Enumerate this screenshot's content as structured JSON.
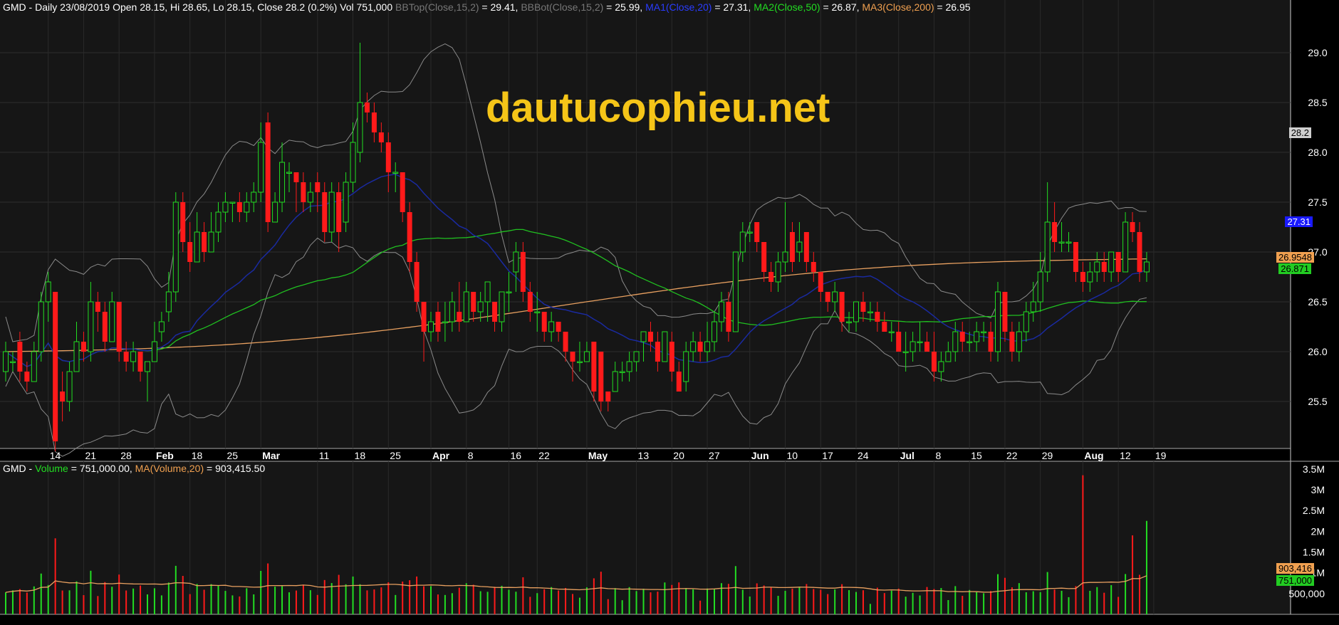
{
  "header": {
    "symbol": "GMD",
    "info": " - Daily 23/08/2019 Open 28.15, Hi 28.65, Lo 28.15, Close 28.2 (0.2%) Vol 751,000 ",
    "bbtop_name": "BBTop(Close,15,2)",
    "bbtop_val": " = 29.41, ",
    "bbbot_name": "BBBot(Close,15,2)",
    "bbbot_val": " = 25.99, ",
    "ma1_name": "MA1(Close,20)",
    "ma1_val": " = 27.31, ",
    "ma2_name": "MA2(Close,50)",
    "ma2_val": " = 26.87, ",
    "ma3_name": "MA3(Close,200)",
    "ma3_val": " = 26.95"
  },
  "volume_header": {
    "symbol": "GMD",
    "dash": " - ",
    "vol_name": "Volume",
    "vol_val": " = 751,000.00, ",
    "ma_name": "MA(Volume,20)",
    "ma_val": " = 903,415.50"
  },
  "watermark": "dautucophieu.net",
  "price_tags": {
    "close": "28.2",
    "ma1": "27.31",
    "ma3": "26.9548",
    "ma2": "26.871"
  },
  "volume_tags": {
    "ma": "903,416",
    "vol": "751,000"
  },
  "colors": {
    "up": "#22dd22",
    "down": "#ff1a1a",
    "ma1": "#1a2aa0",
    "ma2": "#20c020",
    "ma3": "#e8a060",
    "bb": "#8a8a8a",
    "watermark": "#f5c518"
  },
  "chart_data": [
    {
      "type": "candlestick",
      "title": "GMD - Daily",
      "y_ticks": [
        25.5,
        26.0,
        26.5,
        27.0,
        27.5,
        28.0,
        28.5,
        29.0
      ],
      "y_tick_labels": [
        "25.5",
        "26.0",
        "26.5",
        "27.0",
        "27.5",
        "28.0",
        "28.5",
        "29.0"
      ],
      "ylim": [
        25.05,
        29.5
      ],
      "x_labels": [
        {
          "i": 6,
          "t": "14",
          "b": false
        },
        {
          "i": 11,
          "t": "21",
          "b": false
        },
        {
          "i": 16,
          "t": "28",
          "b": false
        },
        {
          "i": 21,
          "t": "Feb",
          "b": true
        },
        {
          "i": 26,
          "t": "18",
          "b": false
        },
        {
          "i": 31,
          "t": "25",
          "b": false
        },
        {
          "i": 36,
          "t": "Mar",
          "b": true
        },
        {
          "i": 44,
          "t": "11",
          "b": false
        },
        {
          "i": 49,
          "t": "18",
          "b": false
        },
        {
          "i": 54,
          "t": "25",
          "b": false
        },
        {
          "i": 60,
          "t": "Apr",
          "b": true
        },
        {
          "i": 65,
          "t": "8",
          "b": false
        },
        {
          "i": 71,
          "t": "16",
          "b": false
        },
        {
          "i": 75,
          "t": "22",
          "b": false
        },
        {
          "i": 82,
          "t": "May",
          "b": true
        },
        {
          "i": 89,
          "t": "13",
          "b": false
        },
        {
          "i": 94,
          "t": "20",
          "b": false
        },
        {
          "i": 99,
          "t": "27",
          "b": false
        },
        {
          "i": 105,
          "t": "Jun",
          "b": true
        },
        {
          "i": 110,
          "t": "10",
          "b": false
        },
        {
          "i": 115,
          "t": "17",
          "b": false
        },
        {
          "i": 120,
          "t": "24",
          "b": false
        },
        {
          "i": 126,
          "t": "Jul",
          "b": true
        },
        {
          "i": 131,
          "t": "8",
          "b": false
        },
        {
          "i": 136,
          "t": "15",
          "b": false
        },
        {
          "i": 141,
          "t": "22",
          "b": false
        },
        {
          "i": 146,
          "t": "29",
          "b": false
        },
        {
          "i": 152,
          "t": "Aug",
          "b": true
        },
        {
          "i": 157,
          "t": "12",
          "b": false
        },
        {
          "i": 162,
          "t": "19",
          "b": false
        }
      ],
      "candles": [
        [
          25.8,
          26.0,
          25.7,
          26.1
        ],
        [
          25.9,
          25.9,
          25.8,
          26.0
        ],
        [
          26.1,
          25.8,
          25.7,
          26.2
        ],
        [
          25.8,
          25.7,
          25.6,
          25.9
        ],
        [
          25.7,
          26.0,
          25.7,
          26.1
        ],
        [
          26.0,
          26.5,
          25.9,
          26.6
        ],
        [
          26.5,
          26.7,
          26.3,
          26.8
        ],
        [
          26.6,
          25.1,
          25.0,
          26.6
        ],
        [
          25.6,
          25.5,
          25.3,
          25.8
        ],
        [
          25.5,
          25.8,
          25.4,
          25.9
        ],
        [
          25.8,
          26.1,
          25.8,
          26.3
        ],
        [
          26.1,
          26.0,
          25.9,
          26.2
        ],
        [
          26.0,
          26.5,
          25.9,
          26.7
        ],
        [
          26.5,
          26.4,
          26.2,
          26.6
        ],
        [
          26.4,
          26.1,
          26.0,
          26.5
        ],
        [
          26.1,
          26.5,
          26.1,
          26.6
        ],
        [
          26.5,
          26.0,
          25.9,
          26.5
        ],
        [
          26.0,
          25.9,
          25.8,
          26.1
        ],
        [
          25.9,
          26.0,
          25.8,
          26.1
        ],
        [
          26.0,
          25.8,
          25.7,
          26.0
        ],
        [
          25.8,
          25.9,
          25.5,
          25.9
        ],
        [
          25.9,
          26.1,
          25.9,
          26.3
        ],
        [
          26.2,
          26.3,
          26.1,
          26.4
        ],
        [
          26.4,
          26.6,
          26.3,
          26.8
        ],
        [
          26.6,
          27.5,
          26.5,
          27.6
        ],
        [
          27.5,
          27.1,
          27.0,
          27.6
        ],
        [
          27.1,
          26.9,
          26.8,
          27.3
        ],
        [
          26.9,
          27.2,
          26.9,
          27.4
        ],
        [
          27.2,
          27.0,
          26.9,
          27.3
        ],
        [
          27.0,
          27.2,
          27.0,
          27.4
        ],
        [
          27.2,
          27.4,
          27.1,
          27.5
        ],
        [
          27.4,
          27.5,
          27.3,
          27.6
        ],
        [
          27.5,
          27.5,
          27.3,
          27.5
        ],
        [
          27.5,
          27.4,
          27.3,
          27.6
        ],
        [
          27.4,
          27.5,
          27.3,
          27.6
        ],
        [
          27.5,
          27.6,
          27.4,
          27.7
        ],
        [
          27.6,
          28.1,
          27.5,
          28.3
        ],
        [
          28.3,
          27.3,
          27.2,
          28.4
        ],
        [
          27.3,
          27.5,
          27.3,
          27.6
        ],
        [
          27.5,
          27.9,
          27.4,
          28.1
        ],
        [
          27.8,
          27.8,
          27.6,
          27.9
        ],
        [
          27.8,
          27.7,
          27.4,
          27.8
        ],
        [
          27.7,
          27.5,
          27.4,
          27.8
        ],
        [
          27.5,
          27.6,
          27.4,
          27.7
        ],
        [
          27.7,
          27.6,
          27.4,
          27.8
        ],
        [
          27.6,
          27.2,
          27.1,
          27.7
        ],
        [
          27.2,
          27.6,
          27.1,
          27.7
        ],
        [
          27.6,
          27.2,
          27.0,
          27.7
        ],
        [
          27.3,
          27.7,
          27.2,
          27.8
        ],
        [
          27.7,
          28.1,
          27.6,
          28.3
        ],
        [
          28.0,
          28.5,
          27.9,
          29.1
        ],
        [
          28.5,
          28.4,
          28.3,
          28.6
        ],
        [
          28.4,
          28.2,
          28.1,
          28.5
        ],
        [
          28.2,
          28.1,
          28.0,
          28.3
        ],
        [
          28.1,
          27.8,
          27.6,
          28.2
        ],
        [
          27.8,
          27.8,
          27.6,
          27.9
        ],
        [
          27.8,
          27.4,
          27.3,
          27.8
        ],
        [
          27.4,
          26.9,
          26.8,
          27.5
        ],
        [
          26.9,
          26.5,
          26.4,
          27.0
        ],
        [
          26.5,
          26.2,
          25.9,
          26.5
        ],
        [
          26.2,
          26.3,
          26.1,
          26.4
        ],
        [
          26.4,
          26.2,
          26.1,
          26.5
        ],
        [
          26.3,
          26.3,
          26.1,
          26.5
        ],
        [
          26.3,
          26.5,
          26.2,
          26.6
        ],
        [
          26.4,
          26.3,
          26.2,
          26.7
        ],
        [
          26.3,
          26.6,
          26.3,
          26.7
        ],
        [
          26.6,
          26.4,
          26.3,
          26.6
        ],
        [
          26.4,
          26.5,
          26.3,
          26.6
        ],
        [
          26.5,
          26.7,
          26.3,
          26.7
        ],
        [
          26.5,
          26.3,
          26.2,
          26.5
        ],
        [
          26.3,
          26.6,
          26.2,
          26.6
        ],
        [
          26.6,
          26.6,
          26.4,
          26.8
        ],
        [
          26.8,
          27.0,
          26.6,
          27.1
        ],
        [
          27.0,
          26.6,
          26.5,
          27.1
        ],
        [
          26.6,
          26.4,
          26.3,
          26.7
        ],
        [
          26.4,
          26.4,
          26.2,
          26.6
        ],
        [
          26.4,
          26.2,
          26.1,
          26.4
        ],
        [
          26.2,
          26.3,
          26.1,
          26.4
        ],
        [
          26.3,
          26.2,
          26.1,
          26.3
        ],
        [
          26.2,
          26.0,
          25.9,
          26.2
        ],
        [
          26.0,
          25.9,
          25.7,
          26.0
        ],
        [
          25.9,
          25.9,
          25.8,
          26.1
        ],
        [
          25.9,
          26.0,
          25.9,
          26.1
        ],
        [
          26.1,
          25.6,
          25.5,
          26.1
        ],
        [
          26.0,
          25.5,
          25.4,
          26.0
        ],
        [
          25.6,
          25.5,
          25.4,
          25.6
        ],
        [
          25.6,
          25.8,
          25.6,
          25.9
        ],
        [
          25.8,
          25.8,
          25.7,
          25.9
        ],
        [
          25.8,
          25.9,
          25.7,
          26.0
        ],
        [
          25.9,
          26.0,
          25.8,
          26.0
        ],
        [
          26.1,
          26.2,
          25.9,
          26.2
        ],
        [
          26.2,
          26.1,
          26.0,
          26.3
        ],
        [
          26.1,
          25.9,
          25.8,
          26.2
        ],
        [
          25.9,
          26.2,
          25.9,
          26.2
        ],
        [
          26.1,
          25.8,
          25.7,
          26.2
        ],
        [
          25.8,
          25.6,
          25.6,
          25.9
        ],
        [
          25.7,
          26.0,
          25.6,
          26.1
        ],
        [
          26.0,
          26.1,
          25.9,
          26.2
        ],
        [
          26.1,
          26.0,
          25.9,
          26.2
        ],
        [
          26.0,
          26.1,
          25.9,
          26.3
        ],
        [
          26.1,
          26.3,
          26.0,
          26.4
        ],
        [
          26.3,
          26.5,
          26.2,
          26.6
        ],
        [
          26.5,
          26.2,
          26.1,
          26.6
        ],
        [
          26.2,
          27.0,
          26.2,
          27.0
        ],
        [
          27.0,
          27.2,
          26.9,
          27.3
        ],
        [
          27.2,
          27.2,
          27.1,
          27.3
        ],
        [
          27.3,
          27.1,
          27.0,
          27.3
        ],
        [
          27.1,
          26.8,
          26.7,
          27.1
        ],
        [
          26.8,
          26.7,
          26.6,
          26.9
        ],
        [
          26.7,
          26.9,
          26.6,
          27.0
        ],
        [
          26.9,
          27.0,
          26.8,
          27.5
        ],
        [
          27.2,
          26.9,
          26.8,
          27.3
        ],
        [
          27.0,
          27.1,
          26.9,
          27.3
        ],
        [
          27.2,
          26.9,
          26.8,
          27.2
        ],
        [
          26.9,
          26.8,
          26.7,
          27.0
        ],
        [
          26.8,
          26.6,
          26.5,
          26.8
        ],
        [
          26.6,
          26.5,
          26.4,
          26.6
        ],
        [
          26.5,
          26.6,
          26.4,
          26.7
        ],
        [
          26.6,
          26.3,
          26.2,
          26.6
        ],
        [
          26.3,
          26.3,
          26.2,
          26.4
        ],
        [
          26.3,
          26.5,
          26.2,
          26.5
        ],
        [
          26.5,
          26.4,
          26.3,
          26.6
        ],
        [
          26.4,
          26.4,
          26.3,
          26.5
        ],
        [
          26.4,
          26.3,
          26.2,
          26.5
        ],
        [
          26.3,
          26.2,
          26.2,
          26.4
        ],
        [
          26.2,
          26.2,
          26.1,
          26.3
        ],
        [
          26.2,
          26.0,
          26.0,
          26.3
        ],
        [
          26.0,
          26.0,
          25.8,
          26.2
        ],
        [
          26.0,
          26.1,
          25.9,
          26.2
        ],
        [
          26.1,
          26.1,
          26.0,
          26.3
        ],
        [
          26.1,
          26.0,
          26.0,
          26.2
        ],
        [
          26.0,
          25.8,
          25.7,
          26.2
        ],
        [
          25.8,
          25.9,
          25.7,
          26.0
        ],
        [
          25.9,
          26.0,
          25.9,
          26.1
        ],
        [
          26.0,
          26.2,
          25.9,
          26.3
        ],
        [
          26.2,
          26.1,
          26.0,
          26.3
        ],
        [
          26.1,
          26.1,
          26.0,
          26.2
        ],
        [
          26.1,
          26.2,
          26.0,
          26.3
        ],
        [
          26.2,
          26.2,
          26.1,
          26.3
        ],
        [
          26.2,
          26.0,
          25.9,
          26.3
        ],
        [
          26.0,
          26.6,
          25.9,
          26.7
        ],
        [
          26.6,
          26.2,
          26.1,
          26.6
        ],
        [
          26.2,
          26.0,
          25.9,
          26.3
        ],
        [
          26.0,
          26.2,
          25.9,
          26.3
        ],
        [
          26.2,
          26.4,
          26.1,
          26.5
        ],
        [
          26.4,
          26.5,
          26.3,
          26.7
        ],
        [
          26.5,
          26.8,
          26.4,
          27.0
        ],
        [
          26.8,
          27.3,
          26.7,
          27.7
        ],
        [
          27.3,
          27.1,
          27.0,
          27.5
        ],
        [
          27.1,
          27.1,
          27.0,
          27.3
        ],
        [
          27.1,
          27.1,
          27.0,
          27.2
        ],
        [
          27.1,
          26.8,
          26.7,
          27.1
        ],
        [
          26.8,
          26.7,
          26.6,
          26.9
        ],
        [
          26.7,
          26.8,
          26.6,
          26.9
        ],
        [
          26.8,
          26.9,
          26.7,
          27.0
        ],
        [
          26.9,
          26.8,
          26.7,
          27.0
        ],
        [
          26.8,
          27.0,
          26.7,
          27.0
        ],
        [
          27.0,
          26.8,
          26.7,
          27.0
        ],
        [
          26.8,
          27.3,
          26.8,
          27.4
        ],
        [
          27.3,
          27.2,
          27.1,
          27.4
        ],
        [
          27.2,
          26.8,
          26.7,
          27.3
        ],
        [
          26.8,
          26.9,
          26.7,
          27.0
        ]
      ],
      "bb_upper": [],
      "bb_lower": [],
      "ma20": [],
      "ma50": [],
      "ma200": []
    },
    {
      "type": "bar",
      "title": "Volume",
      "y_tick_labels": [
        "500,000",
        "1M",
        "1.5M",
        "2M",
        "2.5M",
        "3M",
        "3.5M"
      ],
      "y_ticks": [
        500000,
        1000000,
        1500000,
        2000000,
        2500000,
        3000000,
        3500000
      ],
      "ylim": [
        0,
        3600000
      ],
      "values": []
    }
  ]
}
